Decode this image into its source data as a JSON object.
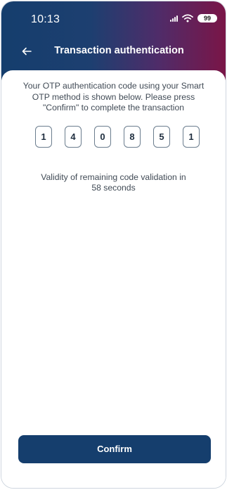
{
  "status_bar": {
    "time": "10:13",
    "battery": "99",
    "icons": [
      "signal-icon",
      "wifi-icon",
      "battery-icon"
    ]
  },
  "header": {
    "title": "Transaction authentication",
    "back_icon": "back-arrow-icon",
    "gradient_colors": [
      "#153e6d",
      "#7a1547"
    ]
  },
  "main": {
    "instructions": "Your OTP authentication code using your Smart OTP method is shown below. Please press \"Confirm\" to complete the transaction",
    "otp_digits": [
      "1",
      "4",
      "0",
      "8",
      "5",
      "1"
    ],
    "validity_text": "Validity of remaining code validation in",
    "remaining_seconds": "58 seconds"
  },
  "actions": {
    "confirm_label": "Confirm",
    "button_color": "#153e6d"
  }
}
